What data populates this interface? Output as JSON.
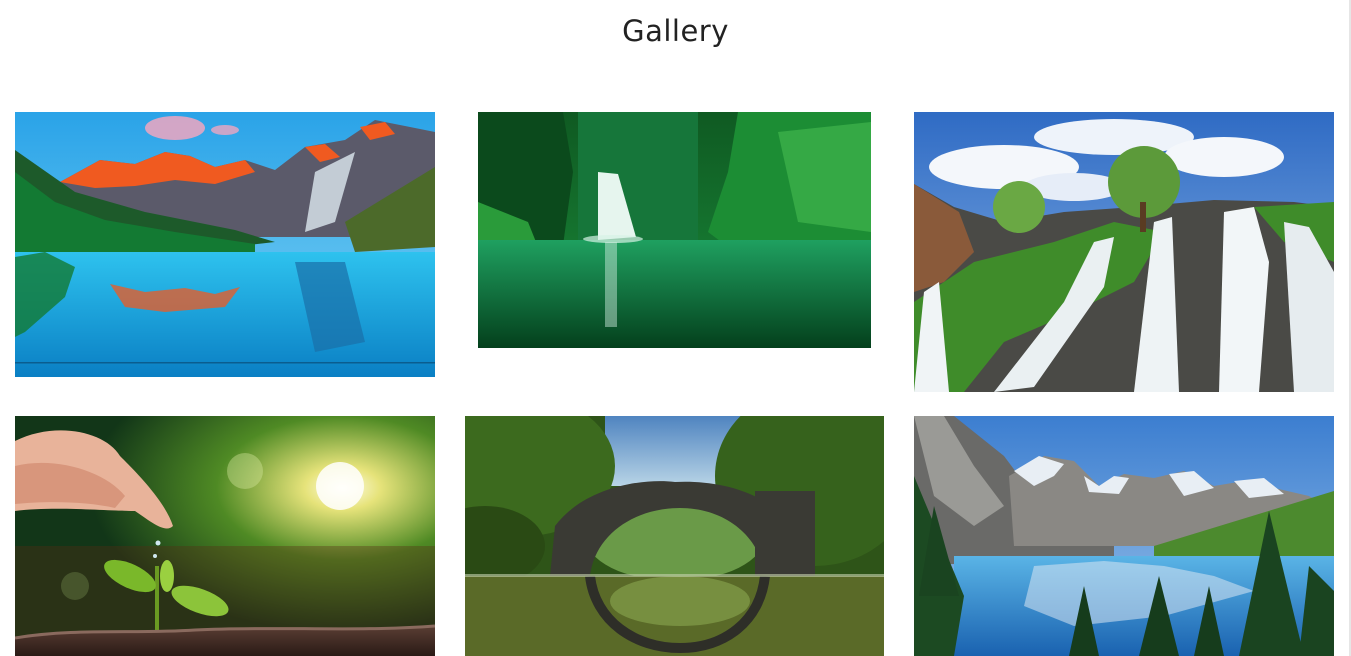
{
  "page": {
    "title": "Gallery"
  },
  "gallery": {
    "images": [
      {
        "subject": "mountain-lake-sunrise"
      },
      {
        "subject": "canyon-waterfall-pool"
      },
      {
        "subject": "cascading-waterfall-cliff"
      },
      {
        "subject": "hand-watering-seedling"
      },
      {
        "subject": "stone-arch-bridge-reflection"
      },
      {
        "subject": "alpine-lake-pine-trees"
      }
    ]
  },
  "colors": {
    "background": "#ffffff",
    "title_text": "#222222"
  }
}
